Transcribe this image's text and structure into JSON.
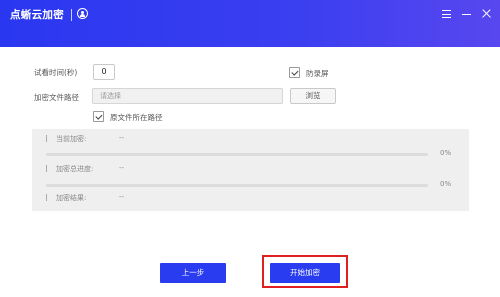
{
  "titlebar": {
    "title": "点蜥云加密",
    "icons": [
      "user-icon",
      "menu-icon",
      "minimize-icon",
      "close-icon"
    ]
  },
  "form": {
    "trial_time_label": "试看时间(秒)",
    "trial_time_value": "0",
    "screen_protect_label": "防录屏",
    "screen_protect_checked": true,
    "encrypt_path_label": "加密文件路径",
    "encrypt_path_placeholder": "请选择",
    "browse_label": "浏览",
    "original_path_label": "原文件所在路径",
    "original_path_checked": true
  },
  "progress": {
    "current_label": "当前加密:",
    "current_value": "--",
    "current_percent": "0%",
    "current_fraction": 0,
    "total_label": "加密总进度:",
    "total_value": "--",
    "total_percent": "0%",
    "total_fraction": 0,
    "result_label": "加密结果:",
    "result_value": "--"
  },
  "actions": {
    "prev_label": "上一步",
    "start_label": "开始加密"
  },
  "colors": {
    "accent": "#2a3cf0",
    "highlight": "#e02020"
  }
}
